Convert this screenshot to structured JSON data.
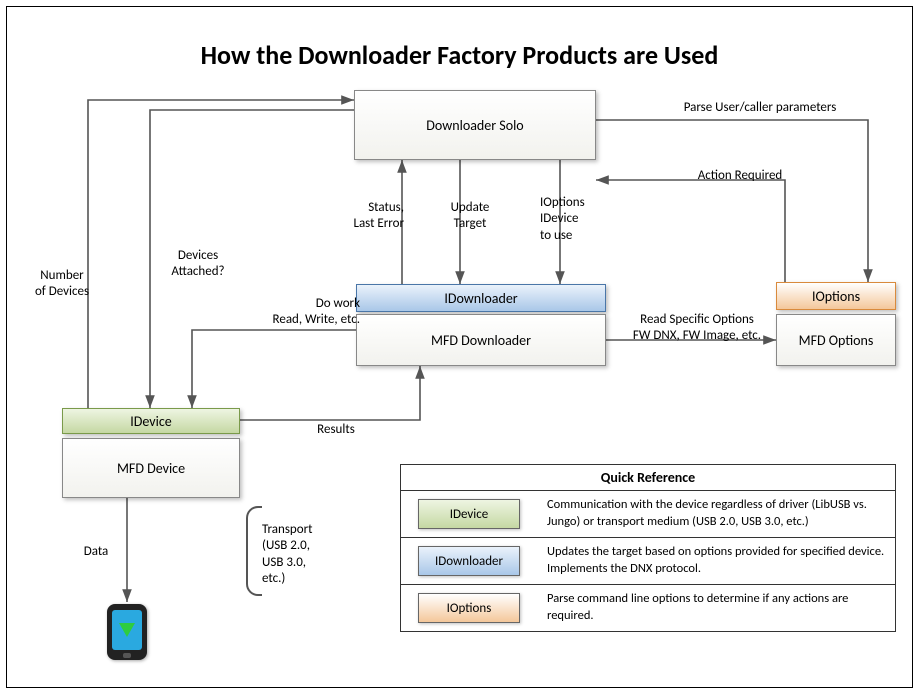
{
  "title": "How the Downloader Factory Products are Used",
  "nodes": {
    "solo": "Downloader Solo",
    "idownloader": "IDownloader",
    "mfd_downloader": "MFD Downloader",
    "ioptions": "IOptions",
    "mfd_options": "MFD Options",
    "idevice": "IDevice",
    "mfd_device": "MFD Device"
  },
  "edges": {
    "parse_params": "Parse User/caller parameters",
    "action_required": "Action Required",
    "ioptions_idevice": "IOptions\nIDevice\nto use",
    "update_target": "Update\nTarget",
    "status_lasterr": "Status,\nLast Error",
    "read_options": "Read Specific Options\nFW DNX, FW Image, etc.",
    "do_work": "Do work\nRead, Write, etc.",
    "results": "Results",
    "devices_attached": "Devices\nAttached?",
    "num_devices": "Number\nof Devices",
    "data": "Data",
    "transport": "Transport\n(USB 2.0,\nUSB 3.0,\netc.)"
  },
  "legend": {
    "title": "Quick Reference",
    "rows": [
      {
        "label": "IDevice",
        "class": "grad-green",
        "text": "Communication with the device regardless of driver (LibUSB vs. Jungo) or transport medium (USB 2.0, USB 3.0, etc.)"
      },
      {
        "label": "IDownloader",
        "class": "grad-blue",
        "text": "Updates the target based on options provided for specified device. Implements the DNX protocol."
      },
      {
        "label": "IOptions",
        "class": "grad-orange",
        "text": "Parse command line options to determine if any actions are required."
      }
    ]
  }
}
